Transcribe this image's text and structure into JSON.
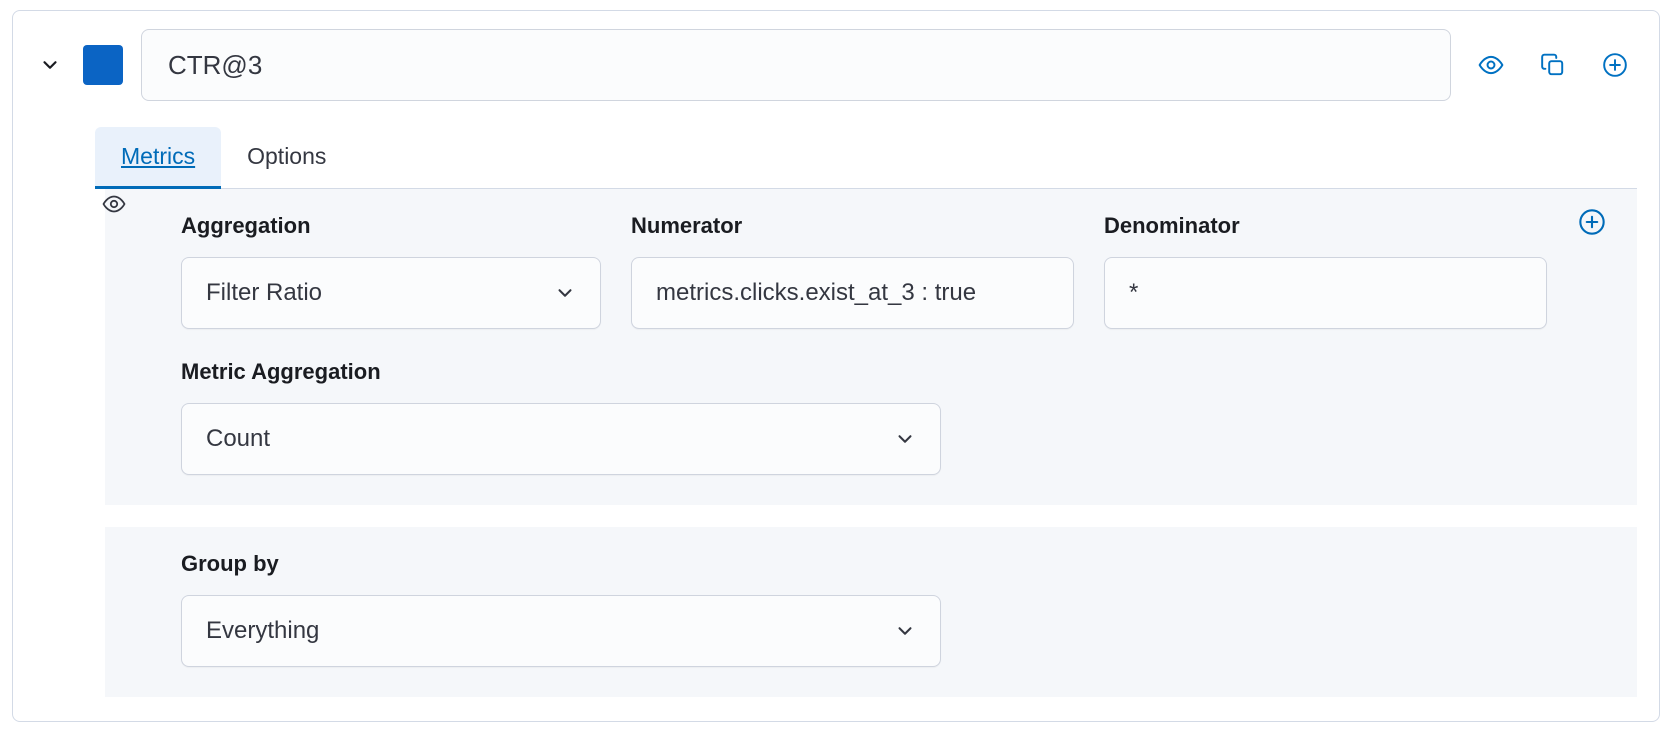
{
  "header": {
    "titleValue": "CTR@3",
    "swatchColor": "#0b64c4"
  },
  "tabs": {
    "metrics": "Metrics",
    "options": "Options"
  },
  "labels": {
    "aggregation": "Aggregation",
    "numerator": "Numerator",
    "denominator": "Denominator",
    "metricAggregation": "Metric Aggregation",
    "groupBy": "Group by"
  },
  "fields": {
    "aggregationValue": "Filter Ratio",
    "numeratorValue": "metrics.clicks.exist_at_3 : true",
    "denominatorValue": "*",
    "metricAggregationValue": "Count",
    "groupByValue": "Everything"
  }
}
